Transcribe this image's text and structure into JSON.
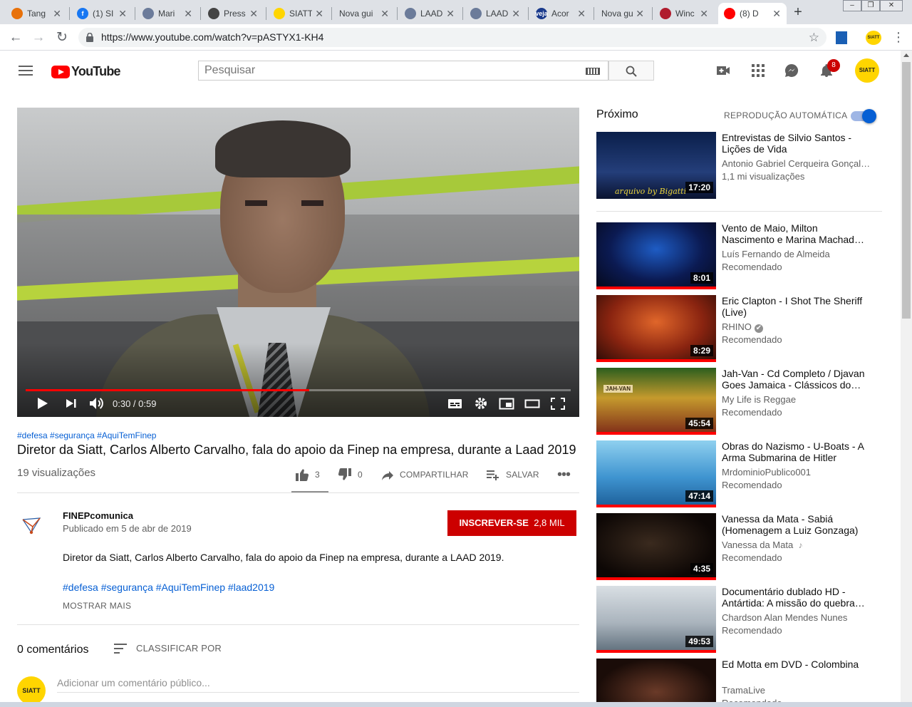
{
  "browser": {
    "tabs": [
      {
        "title": "Tang",
        "fav_color": "#e8710a",
        "fav": ""
      },
      {
        "title": "(1) SI",
        "fav_color": "#1877f2",
        "fav": "f"
      },
      {
        "title": "Mari",
        "fav_color": "#6b7b9a",
        "fav": ""
      },
      {
        "title": "Press",
        "fav_color": "#444444",
        "fav": ""
      },
      {
        "title": "SIATT",
        "fav_color": "#ffd500",
        "fav": ""
      },
      {
        "title": "Nova gui",
        "fav_color": "",
        "fav": ""
      },
      {
        "title": "LAAD",
        "fav_color": "#6b7b9a",
        "fav": ""
      },
      {
        "title": "LAAD",
        "fav_color": "#6b7b9a",
        "fav": ""
      },
      {
        "title": "Acor",
        "fav_color": "#1a3a8c",
        "fav": "veja"
      },
      {
        "title": "Nova gui",
        "fav_color": "",
        "fav": ""
      },
      {
        "title": "Winc",
        "fav_color": "#b01c2e",
        "fav": ""
      },
      {
        "title": "(8) D",
        "fav_color": "#ff0000",
        "fav": ""
      }
    ],
    "active_tab_index": 11,
    "new_tab_label": "+",
    "url": "https://www.youtube.com/watch?v=pASTYX1-KH4",
    "extension_badge": "SIATT"
  },
  "masthead": {
    "logo_text": "YouTube",
    "search_placeholder": "Pesquisar",
    "notification_count": "8",
    "avatar_text": "SIATT"
  },
  "player": {
    "time": "0:30 / 0:59",
    "progress": 0.52,
    "buffered": 1.0
  },
  "video": {
    "hashtags": "#defesa #segurança #AquiTemFinep",
    "title": "Diretor da Siatt, Carlos Alberto Carvalho, fala do apoio da Finep na empresa, durante a Laad 2019",
    "views": "19 visualizações",
    "likes": "3",
    "dislikes": "0",
    "share_label": "COMPARTILHAR",
    "save_label": "SALVAR"
  },
  "channel": {
    "name": "FINEPcomunica",
    "published": "Publicado em 5 de abr de 2019",
    "subscribe_label": "INSCREVER-SE",
    "subscriber_count": "2,8 MIL",
    "description": "Diretor da Siatt, Carlos Alberto Carvalho, fala do apoio da Finep na empresa, durante a LAAD 2019.",
    "description_tags": "#defesa #segurança #AquiTemFinep #laad2019",
    "show_more": "MOSTRAR MAIS"
  },
  "comments": {
    "count_label": "0 comentários",
    "sort_label": "CLASSIFICAR POR",
    "input_placeholder": "Adicionar um comentário público...",
    "avatar_text": "SIATT"
  },
  "sidebar": {
    "up_next_label": "Próximo",
    "autoplay_label": "REPRODUÇÃO AUTOMÁTICA",
    "autoplay_on": true,
    "items": [
      {
        "title": "Entrevistas de Silvio Santos - Lições de Vida",
        "channel": "Antonio Gabriel Cerqueira Gonçal…",
        "meta": "1,1 mi visualizações",
        "duration": "17:20",
        "thumb_text": "arquivo by Bigatti"
      },
      {
        "title": "Vento de Maio, Milton Nascimento e Marina Machad…",
        "channel": "Luís Fernando de Almeida",
        "meta": "Recomendado",
        "duration": "8:01"
      },
      {
        "title": "Eric Clapton - I Shot The Sheriff (Live)",
        "channel": "RHINO",
        "meta": "Recomendado",
        "duration": "8:29",
        "verified": true
      },
      {
        "title": "Jah-Van - Cd Completo / Djavan Goes Jamaica - Clássicos do…",
        "channel": "My Life is Reggae",
        "meta": "Recomendado",
        "duration": "45:54",
        "thumb_text": "JAH-VAN"
      },
      {
        "title": "Obras do Nazismo - U-Boats - A Arma Submarina de Hitler",
        "channel": "MrdominioPublico001",
        "meta": "Recomendado",
        "duration": "47:14"
      },
      {
        "title": "Vanessa da Mata - Sabiá (Homenagem a Luiz Gonzaga)",
        "channel": "Vanessa da Mata",
        "meta": "Recomendado",
        "duration": "4:35",
        "music": true
      },
      {
        "title": "Documentário dublado HD - Antártida: A missão do quebra…",
        "channel": "Chardson Alan Mendes Nunes",
        "meta": "Recomendado",
        "duration": "49:53"
      },
      {
        "title": "Ed Motta em DVD - Colombina",
        "channel": "TramaLive",
        "meta": "Recomendado",
        "duration": ""
      }
    ]
  }
}
